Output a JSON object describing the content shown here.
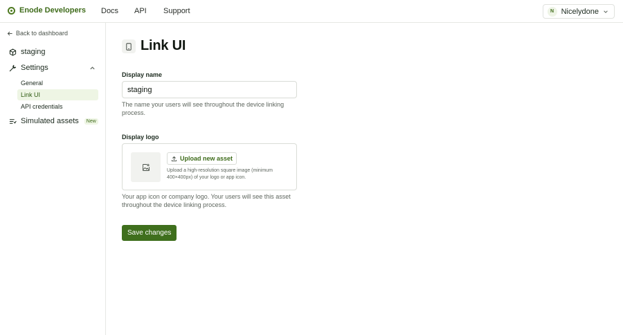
{
  "header": {
    "brand": "Enode Developers",
    "nav": [
      {
        "label": "Docs"
      },
      {
        "label": "API"
      },
      {
        "label": "Support"
      }
    ],
    "user": {
      "initial": "N",
      "name": "Nicelydone"
    }
  },
  "sidebar": {
    "back_label": "Back to dashboard",
    "items": [
      {
        "label": "staging",
        "icon": "cube-icon"
      },
      {
        "label": "Settings",
        "icon": "wrench-icon"
      }
    ],
    "settings_sub": [
      {
        "label": "General",
        "active": false
      },
      {
        "label": "Link UI",
        "active": true
      },
      {
        "label": "API credentials",
        "active": false
      }
    ],
    "simulated": {
      "label": "Simulated assets",
      "badge": "New",
      "icon": "list-icon"
    }
  },
  "main": {
    "title": "Link UI",
    "display_name": {
      "label": "Display name",
      "value": "staging",
      "help": "The name your users will see throughout the device linking process."
    },
    "display_logo": {
      "label": "Display logo",
      "upload_label": "Upload new asset",
      "upload_hint": "Upload a high-resolution square image (minimum 400×400px) of your logo or app icon.",
      "help": "Your app icon or company logo. Your users will see this asset throughout the device linking process."
    },
    "save_label": "Save changes"
  },
  "colors": {
    "brand": "#3e6b1a",
    "button": "#3f6f1d",
    "active_bg": "#eef5e4"
  }
}
